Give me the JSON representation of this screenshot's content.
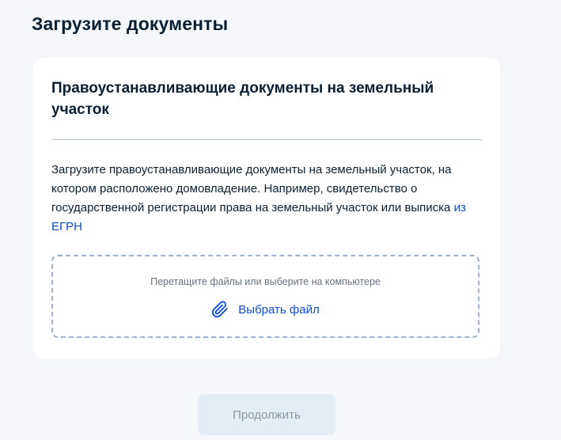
{
  "page": {
    "title": "Загрузите документы"
  },
  "card": {
    "title": "Правоустанавливающие документы на земельный участок",
    "description": "Загрузите правоустанавливающие документы на земельный участок, на котором расположено домовладение. Например, свидетельство о государственной регистрации права на земельный участок или выписка",
    "description_link": "из ЕГРН"
  },
  "dropzone": {
    "hint": "Перетащите файлы или выберите на компьютере",
    "choose_label": "Выбрать файл",
    "icon": "paperclip-icon"
  },
  "actions": {
    "continue_label": "Продолжить",
    "continue_disabled": true
  },
  "colors": {
    "background": "#f5f7fa",
    "card": "#ffffff",
    "text": "#0b1f33",
    "link": "#0d4cd3",
    "dropzone_border": "#9bb3cf",
    "button_disabled_bg": "#e4ecf4",
    "button_disabled_text": "#8a97a4"
  }
}
